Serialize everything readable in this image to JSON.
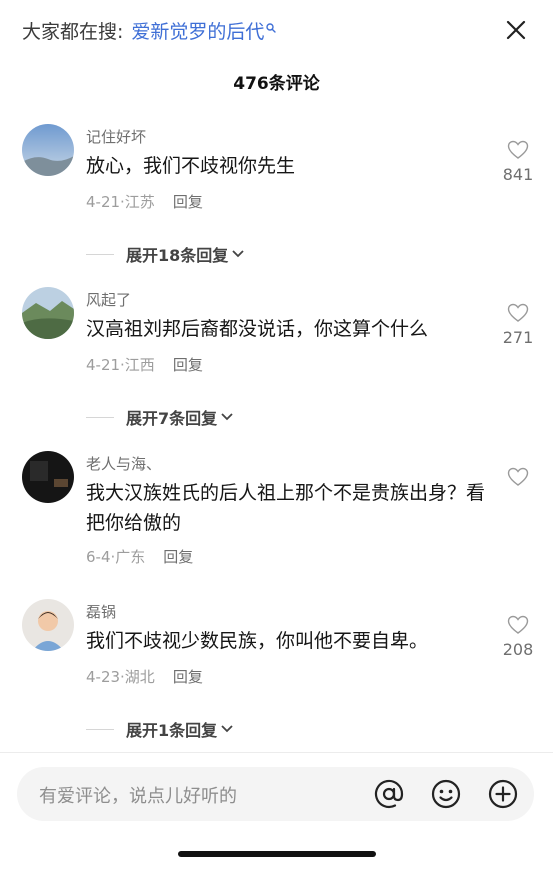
{
  "search": {
    "prefix": "大家都在搜:",
    "term": "爱新觉罗的后代"
  },
  "header": {
    "comment_count": "476条评论"
  },
  "comments": [
    {
      "name": "记住好坏",
      "text": "放心，我们不歧视你先生",
      "date": "4-21·江苏",
      "reply": "回复",
      "likes": "841",
      "expand": "展开18条回复"
    },
    {
      "name": "风起了",
      "text": "汉高祖刘邦后裔都没说话，你这算个什么",
      "date": "4-21·江西",
      "reply": "回复",
      "likes": "271",
      "expand": "展开7条回复"
    },
    {
      "name": "老人与海、",
      "text": "我大汉族姓氏的后人祖上那个不是贵族出身？看把你给傲的",
      "date": "6-4·广东",
      "reply": "回复",
      "likes": "",
      "expand": ""
    },
    {
      "name": "磊锅",
      "text": "我们不歧视少数民族，你叫他不要自卑。",
      "date": "4-23·湖北",
      "reply": "回复",
      "likes": "208",
      "expand": "展开1条回复"
    }
  ],
  "composer": {
    "placeholder": "有爱评论，说点儿好听的"
  },
  "icons": [
    "search-icon",
    "close-icon",
    "heart-icon",
    "chevron-down-icon",
    "at-icon",
    "emoji-icon",
    "plus-icon"
  ],
  "colors": {
    "accent": "#3f6fd6",
    "text": "#161616",
    "muted": "#9d9d9d"
  }
}
